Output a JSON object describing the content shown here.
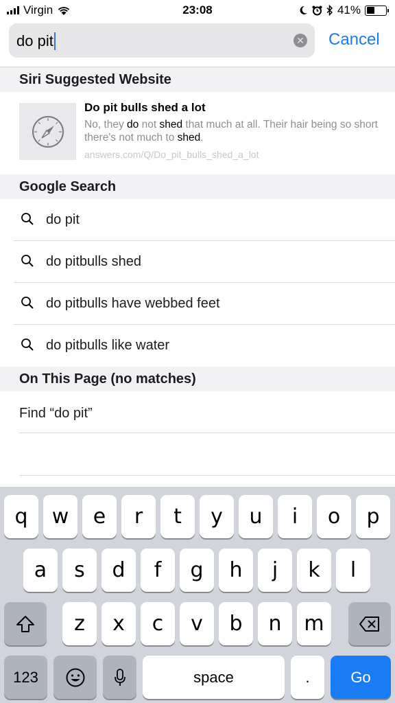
{
  "status_bar": {
    "carrier": "Virgin",
    "time": "23:08",
    "battery_percent": "41%",
    "battery_level": 0.41,
    "icons": [
      "signal-icon",
      "wifi-icon",
      "moon-icon",
      "alarm-icon",
      "bluetooth-icon",
      "battery-icon"
    ]
  },
  "search": {
    "query": "do pit",
    "cancel_label": "Cancel"
  },
  "siri_section": {
    "header": "Siri Suggested Website",
    "title": "Do pit bulls shed a lot",
    "desc_parts": [
      "No, they ",
      "do",
      " not ",
      "shed",
      " that much at all. Their hair being so short there's not much to ",
      "shed",
      "."
    ],
    "url": "answers.com/Q/Do_pit_bulls_shed_a_lot"
  },
  "google_section": {
    "header": "Google Search",
    "suggestions": [
      "do pit",
      "do pitbulls shed",
      "do pitbulls have webbed feet",
      "do pitbulls like water"
    ]
  },
  "page_section": {
    "header": "On This Page (no matches)",
    "find_label": "Find “do pit”"
  },
  "keyboard": {
    "row1": [
      "q",
      "w",
      "e",
      "r",
      "t",
      "y",
      "u",
      "i",
      "o",
      "p"
    ],
    "row2": [
      "a",
      "s",
      "d",
      "f",
      "g",
      "h",
      "j",
      "k",
      "l"
    ],
    "row3": [
      "z",
      "x",
      "c",
      "v",
      "b",
      "n",
      "m"
    ],
    "numbers_label": "123",
    "space_label": "space",
    "period_label": ".",
    "go_label": "Go"
  },
  "colors": {
    "accent": "#1a7cf5",
    "caret": "#3f6ee9",
    "keyboard_bg": "#d1d4da"
  }
}
